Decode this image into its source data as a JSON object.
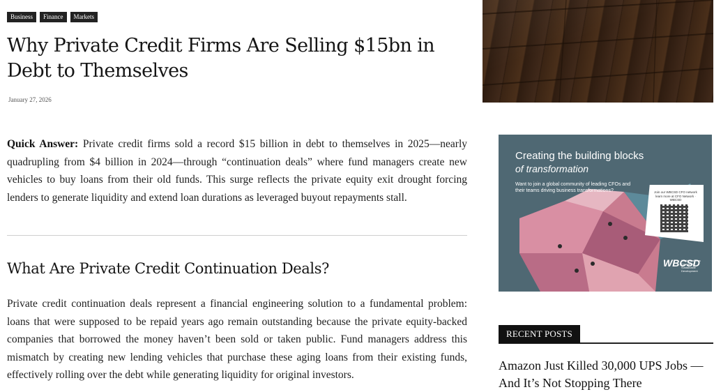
{
  "article": {
    "tags": [
      "Business",
      "Finance",
      "Markets"
    ],
    "title": "Why Private Credit Firms Are Selling $15bn in Debt to Themselves",
    "date": "January 27, 2026",
    "quick_answer_label": "Quick Answer:",
    "quick_answer_text": " Private credit firms sold a record $15 billion in debt to themselves in 2025—nearly quadrupling from $4 billion in 2024—through “continuation deals” where fund managers create new vehicles to buy loans from their old funds. This surge reflects the private equity exit drought forcing lenders to generate liquidity and extend loan durations as leveraged buyout repayments stall.",
    "section_heading": "What Are Private Credit Continuation Deals?",
    "section_body": "Private credit continuation deals represent a financial engineering solution to a fundamental problem: loans that were supposed to be repaid years ago remain outstanding because the private equity-backed companies that borrowed the money haven’t been sold or taken public. Fund managers address this mismatch by creating new lending vehicles that purchase these aging loans from their existing funds, effectively rolling over the debt while generating liquidity for original investors."
  },
  "ad": {
    "headline": "Creating the building blocks",
    "headline_italic": "of transformation",
    "body": "Want to join a global community of leading CFOs and their teams driving business transformations?",
    "card_text": "Join our WBCSD CFO network learn more at CFO Network · WBCSD",
    "logo": "WBCSD",
    "logo_sub": "World Business Council for Sustainable Development",
    "bg_color": "#4f6873"
  },
  "sidebar": {
    "recent_posts_label": "RECENT POSTS",
    "recent_posts": [
      "Amazon Just Killed 30,000 UPS Jobs — And It’s Not Stopping There"
    ]
  }
}
